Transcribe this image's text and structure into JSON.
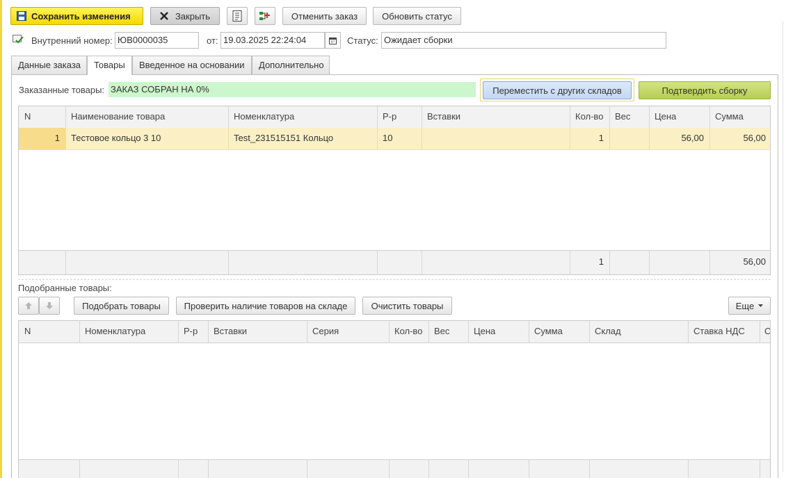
{
  "toolbar": {
    "save_label": "Сохранить изменения",
    "close_label": "Закрыть",
    "cancel_order_label": "Отменить заказ",
    "update_status_label": "Обновить статус"
  },
  "header": {
    "internal_number_label": "Внутренний номер:",
    "internal_number_value": "ЮВ0000035",
    "from_label": "от:",
    "date_value": "19.03.2025 22:24:04",
    "status_label": "Статус:",
    "status_value": "Ожидает сборки"
  },
  "tabs": [
    {
      "label": "Данные заказа",
      "active": false
    },
    {
      "label": "Товары",
      "active": true
    },
    {
      "label": "Введенное на основании",
      "active": false
    },
    {
      "label": "Дополнительно",
      "active": false
    }
  ],
  "ordered": {
    "label": "Заказанные товары:",
    "progress_text": "ЗАКАЗ СОБРАН НА 0%",
    "move_button": "Переместить с других складов",
    "confirm_button": "Подтвердить сборку",
    "columns": [
      "N",
      "Наименование товара",
      "Номенклатура",
      "Р-р",
      "Вставки",
      "Кол-во",
      "Вес",
      "Цена",
      "Сумма"
    ],
    "rows": [
      {
        "n": "1",
        "name": "Тестовое кольцо 3 10",
        "nomenclature": "Test_231515151 Кольцо",
        "size": "10",
        "inserts": "",
        "qty": "1",
        "weight": "",
        "price": "56,00",
        "sum": "56,00"
      }
    ],
    "footer": {
      "qty": "1",
      "sum": "56,00"
    }
  },
  "selected": {
    "label": "Подобранные товары:",
    "select_button": "Подобрать товары",
    "check_button": "Проверить наличие товаров на складе",
    "clear_button": "Очистить товары",
    "more_button": "Еще",
    "columns": [
      "N",
      "Номенклатура",
      "Р-р",
      "Вставки",
      "Серия",
      "Кол-во",
      "Вес",
      "Цена",
      "Сумма",
      "Склад",
      "Ставка НДС",
      "С"
    ]
  }
}
